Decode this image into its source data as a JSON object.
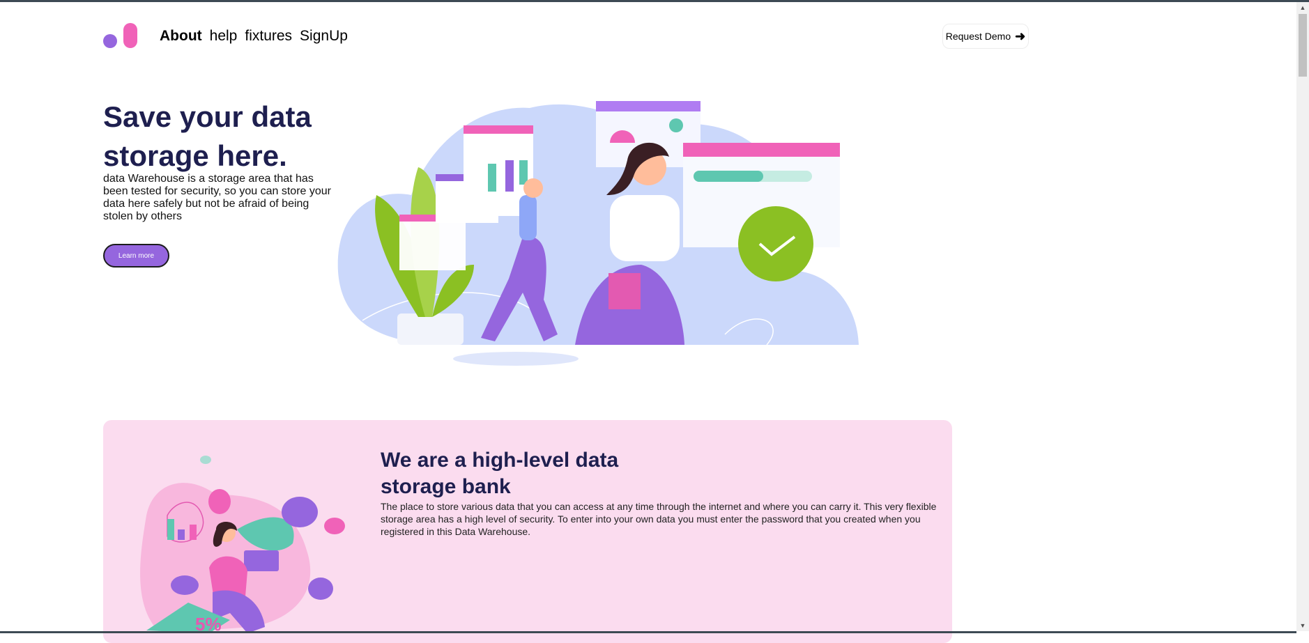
{
  "nav": {
    "items": [
      {
        "label": "About",
        "active": true
      },
      {
        "label": "help",
        "active": false
      },
      {
        "label": "fixtures",
        "active": false
      },
      {
        "label": "SignUp",
        "active": false
      }
    ],
    "request_demo": "Request Demo",
    "arrow_icon": "arrow-right-icon"
  },
  "hero": {
    "title": "Save your data storage here.",
    "description": "data Warehouse is a storage area that has been tested for security, so you can store your data here safely but not be afraid of being stolen by others",
    "cta": "Learn more"
  },
  "about": {
    "title": "We are a high-level data storage bank",
    "description": "The place to store various data that you can access at any time through the internet and where you can carry it. This very flexible storage area has a high level of security. To enter into your own data you must enter the password that you created when you registered in this Data Warehouse.",
    "illustration_text": "5%"
  },
  "colors": {
    "heading": "#1e1f4f",
    "accent_purple": "#9566de",
    "accent_pink": "#f062b8",
    "card_bg": "#fbdcef",
    "hero_blob": "#cbd8fb",
    "check_green": "#8bc023"
  }
}
